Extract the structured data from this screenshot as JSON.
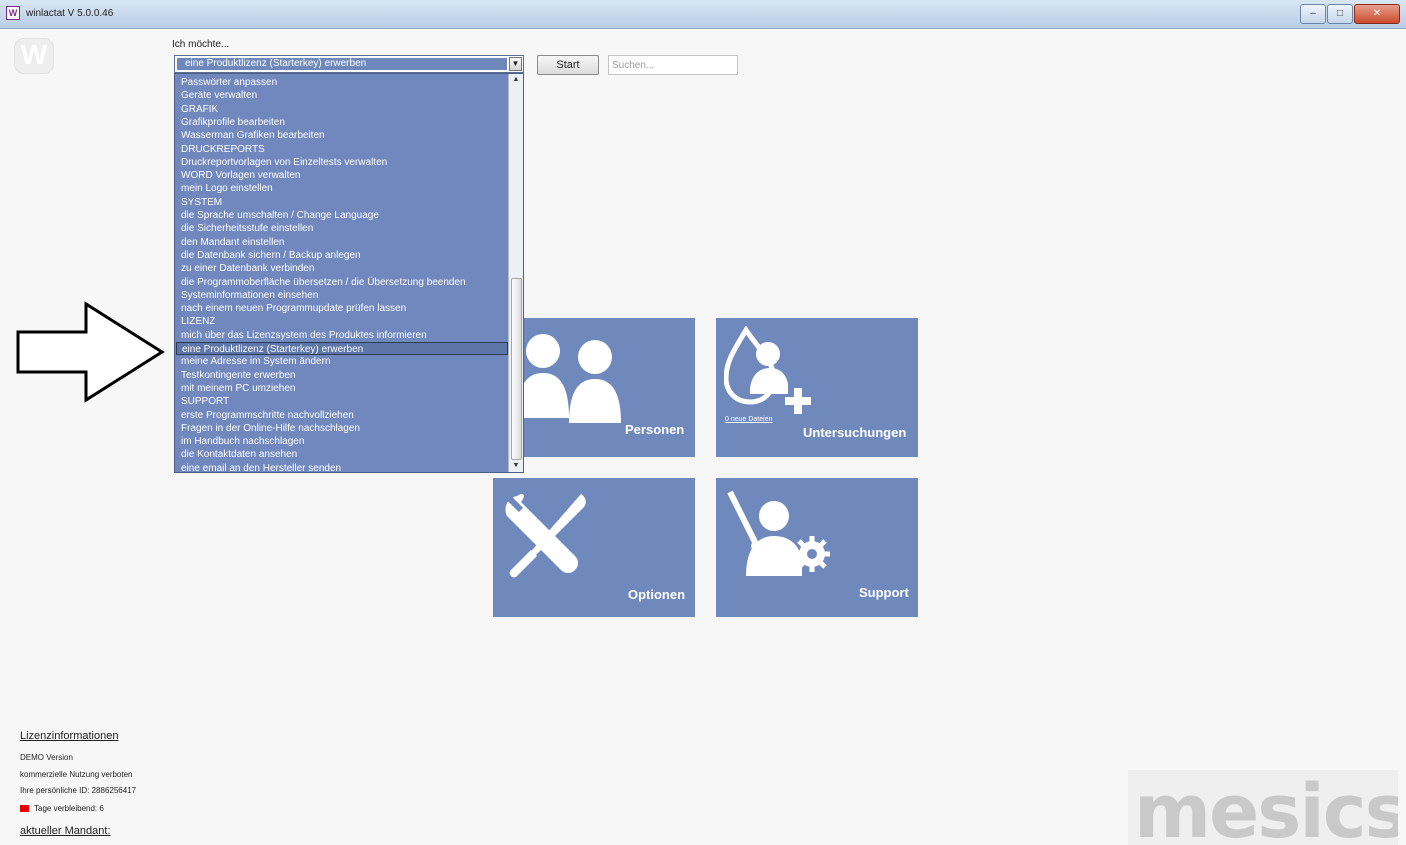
{
  "window": {
    "title": "winlactat V 5.0.0.46",
    "icon": "app-logo-icon",
    "buttons": [
      "minimize-icon",
      "maximize-icon",
      "close-icon"
    ]
  },
  "app_logo": "W",
  "search_bar": {
    "label": "Ich möchte...",
    "selected_value": "eine Produktlizenz (Starterkey) erwerben",
    "start_label": "Start",
    "search_placeholder": "Suchen..."
  },
  "dropdown": {
    "items": [
      "Passwörter anpassen",
      "Geräte verwalten",
      "GRAFIK",
      "Grafikprofile bearbeiten",
      "Wasserman Grafiken bearbeiten",
      "DRUCKREPORTS",
      "Druckreportvorlagen von Einzeltests verwalten",
      "WORD Vorlagen verwalten",
      "mein Logo einstellen",
      "SYSTEM",
      "die Sprache umschalten / Change Language",
      "die Sicherheitsstufe einstellen",
      "den Mandant einstellen",
      "die Datenbank sichern / Backup anlegen",
      "zu einer Datenbank verbinden",
      "die Programmoberfläche übersetzen / die Übersetzung beenden",
      "Systeminformationen einsehen",
      "nach einem neuen Programmupdate prüfen lassen",
      "LIZENZ",
      "mich über das Lizenzsystem des Produktes informieren",
      "eine Produktlizenz (Starterkey) erwerben",
      "meine Adresse im System ändern",
      "Testkontingente erwerben",
      "mit meinem PC umziehen",
      "SUPPORT",
      "erste Programmschritte nachvollziehen",
      "Fragen in der Online-Hilfe nachschlagen",
      "im Handbuch nachschlagen",
      "die Kontaktdaten ansehen",
      "eine email an den Hersteller senden"
    ],
    "selected_index": 20
  },
  "tiles": {
    "personen": {
      "label": "Personen",
      "icon": "persons-icon"
    },
    "untersuchungen": {
      "label": "Untersuchungen",
      "sub": "0 neue Dateien",
      "icon": "examination-icon"
    },
    "optionen": {
      "label": "Optionen",
      "icon": "tools-icon"
    },
    "support": {
      "label": "Support",
      "icon": "support-icon"
    }
  },
  "license": {
    "title": "Lizenzinformationen",
    "version": "DEMO Version",
    "usage": "kommerzielle Nutzung verboten",
    "personal_id": "Ihre persönliche ID: 2886256417",
    "days_left": "Tage verbleibend: 6",
    "mandant": "aktueller Mandant:"
  },
  "brand": {
    "text": "mesics"
  },
  "colors": {
    "tile": "#6f89bd",
    "dropdown": "#7088bd",
    "accent_red": "#e60000"
  }
}
